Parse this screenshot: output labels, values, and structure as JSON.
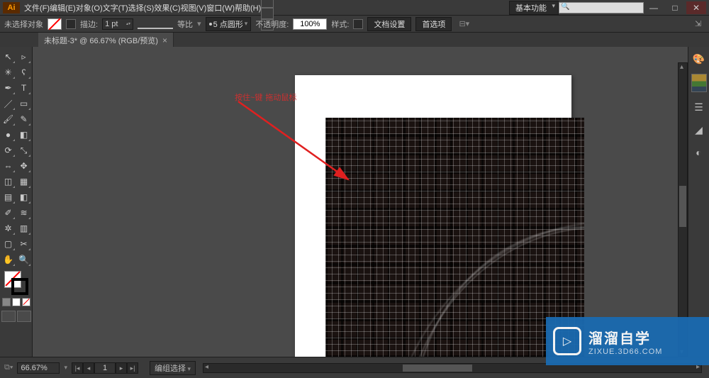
{
  "app": {
    "logo": "Ai"
  },
  "window_buttons": {
    "min": "—",
    "max": "□",
    "close": "✕"
  },
  "menus": [
    "文件(F)",
    "编辑(E)",
    "对象(O)",
    "文字(T)",
    "选择(S)",
    "效果(C)",
    "视图(V)",
    "窗口(W)",
    "帮助(H)"
  ],
  "workspace": {
    "preset": "基本功能"
  },
  "control": {
    "no_selection": "未选择对象",
    "stroke_label": "描边:",
    "stroke_weight": "1 pt",
    "uniform": "等比",
    "brush": "5 点圆形",
    "opacity_label": "不透明度:",
    "opacity_value": "100%",
    "style_label": "样式:",
    "doc_setup": "文档设置",
    "prefs": "首选项"
  },
  "document": {
    "tab": "未标题-3* @ 66.67% (RGB/预览)"
  },
  "annotation": {
    "text1": "按住~键",
    "text2": "拖动鼠标"
  },
  "status": {
    "zoom": "66.67%",
    "artboard": "1",
    "selection_label": "编组选择"
  },
  "watermark": {
    "title": "溜溜自学",
    "url": "ZIXUE.3D66.COM"
  },
  "tools": {
    "r0": [
      "selection",
      "direct-selection"
    ],
    "r1": [
      "magic-wand",
      "lasso"
    ],
    "r2": [
      "pen",
      "type"
    ],
    "r3": [
      "line",
      "rectangle"
    ],
    "r4": [
      "paintbrush",
      "pencil"
    ],
    "r5": [
      "blob-brush",
      "eraser"
    ],
    "r6": [
      "rotate",
      "scale"
    ],
    "r7": [
      "width",
      "free-transform"
    ],
    "r8": [
      "shape-builder",
      "perspective"
    ],
    "r9": [
      "mesh",
      "gradient"
    ],
    "r10": [
      "eyedropper",
      "blend"
    ],
    "r11": [
      "symbol-sprayer",
      "column-graph"
    ],
    "r12": [
      "artboard",
      "slice"
    ],
    "r13": [
      "hand",
      "zoom"
    ]
  },
  "glyphs": {
    "selection": "↖",
    "direct-selection": "▹",
    "magic-wand": "✳",
    "lasso": "ʕ",
    "pen": "✒",
    "type": "T",
    "line": "／",
    "rectangle": "▭",
    "paintbrush": "🖌",
    "pencil": "✎",
    "blob-brush": "●",
    "eraser": "◧",
    "rotate": "⟳",
    "scale": "⤡",
    "width": "⇔",
    "free-transform": "✥",
    "shape-builder": "◫",
    "perspective": "▦",
    "mesh": "▤",
    "gradient": "◧",
    "eyedropper": "✐",
    "blend": "≋",
    "symbol-sprayer": "✲",
    "column-graph": "▥",
    "artboard": "▢",
    "slice": "✂",
    "hand": "✋",
    "zoom": "🔍"
  },
  "right_dock": [
    "color",
    "swatches",
    "stroke",
    "brushes",
    "symbols",
    "layers"
  ]
}
